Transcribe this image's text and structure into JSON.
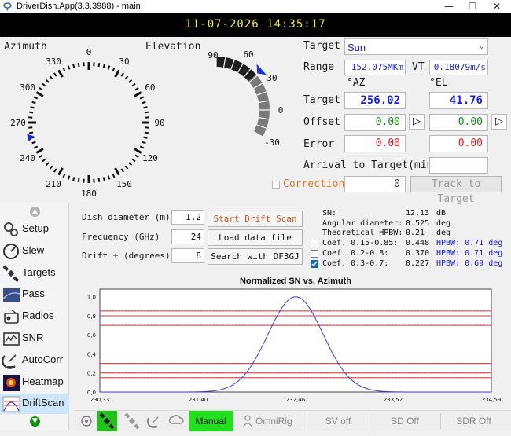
{
  "window": {
    "title": "DriverDish.App(3.3.3988) - main",
    "datetime": "11-07-2026 14:35:17"
  },
  "dials": {
    "azimuth_label": "Azimuth",
    "elevation_label": "Elevation",
    "az_ticks": [
      "0",
      "30",
      "60",
      "90",
      "120",
      "150",
      "180",
      "210",
      "240",
      "270",
      "300",
      "330"
    ],
    "el_ticks": [
      "90",
      "60",
      "30",
      "0",
      "-30"
    ],
    "az_value_deg": 256.02,
    "el_value_deg": 41.76
  },
  "target": {
    "target_label": "Target",
    "target_value": "Sun",
    "range_label": "Range",
    "range_value": "152.075MKm",
    "vt_label": "VT",
    "vt_value": "0.18079m/s",
    "az_header": "°AZ",
    "el_header": "°EL",
    "row_target_label": "Target",
    "target_az": "256.02",
    "target_el": "41.76",
    "offset_label": "Offset",
    "offset_az": "0.00",
    "offset_el": "0.00",
    "error_label": "Error",
    "error_az": "0.00",
    "error_el": "0.00",
    "arrival_label": "Arrival to Target(min)",
    "arrival_value": "",
    "correction_label": "Correction",
    "correction_value": "0",
    "track_button": "Track to Target"
  },
  "sidebar": {
    "items": [
      {
        "label": "Setup",
        "icon": "gears-icon"
      },
      {
        "label": "Slew",
        "icon": "gauge-icon"
      },
      {
        "label": "Targets",
        "icon": "satellite-icon"
      },
      {
        "label": "Pass",
        "icon": "pass-icon"
      },
      {
        "label": "Radios",
        "icon": "radio-icon"
      },
      {
        "label": "SNR",
        "icon": "snr-icon"
      },
      {
        "label": "AutoCorr",
        "icon": "dish-icon"
      },
      {
        "label": "Heatmap",
        "icon": "heatmap-icon"
      },
      {
        "label": "DriftScan",
        "icon": "driftscan-icon"
      }
    ]
  },
  "drift": {
    "dish_label": "Dish diameter (m)",
    "dish_value": "1.2",
    "freq_label": "Frecuency (GHz)",
    "freq_value": "24",
    "drift_label": "Drift ± (degrees)",
    "drift_value": "8",
    "start_button": "Start Drift Scan",
    "load_button": "Load data file",
    "search_button": "Search with DF3GJ",
    "sn_label": "SN:",
    "sn_value": "12.13",
    "sn_unit": "dB",
    "ang_label": "Angular diameter:",
    "ang_value": "0.525",
    "ang_unit": "deg",
    "hpbw_label": "Theoretical HPBW:",
    "hpbw_value": "0.21",
    "hpbw_unit": "deg",
    "coefs": [
      {
        "label": "Coef. 0.15-0.85:",
        "value": "0.448",
        "hpbw": "HPBW: 0.71 deg",
        "checked": false
      },
      {
        "label": "Coef. 0.2-0.8:",
        "value": "0.370",
        "hpbw": "HPBW: 0.71 deg",
        "checked": false
      },
      {
        "label": "Coef. 0.3-0.7:",
        "value": "0.227",
        "hpbw": "HPBW: 0.69 deg",
        "checked": true
      }
    ]
  },
  "chart_data": {
    "type": "line",
    "title": "Normalized SN vs. Azimuth",
    "xlabel": "",
    "ylabel": "",
    "x_ticks": [
      "230,33",
      "231,40",
      "232,46",
      "233,52",
      "234,59"
    ],
    "y_ticks": [
      "0,0",
      "0,2",
      "0,4",
      "0,6",
      "0,8",
      "1,0"
    ],
    "xlim": [
      230.33,
      234.59
    ],
    "ylim": [
      0,
      1.08
    ],
    "series": [
      {
        "peak_x": 232.46,
        "peak_y": 1.0,
        "sigma": 0.3
      }
    ],
    "reference_lines": [
      0.15,
      0.2,
      0.3,
      0.7,
      0.8,
      0.85
    ],
    "grid": true
  },
  "bottombar": {
    "manual_label": "Manual",
    "omnirig_label": "OmniRig",
    "sv_label": "SV off",
    "sd_label": "SD Off",
    "sdr_label": "SDR Off"
  }
}
